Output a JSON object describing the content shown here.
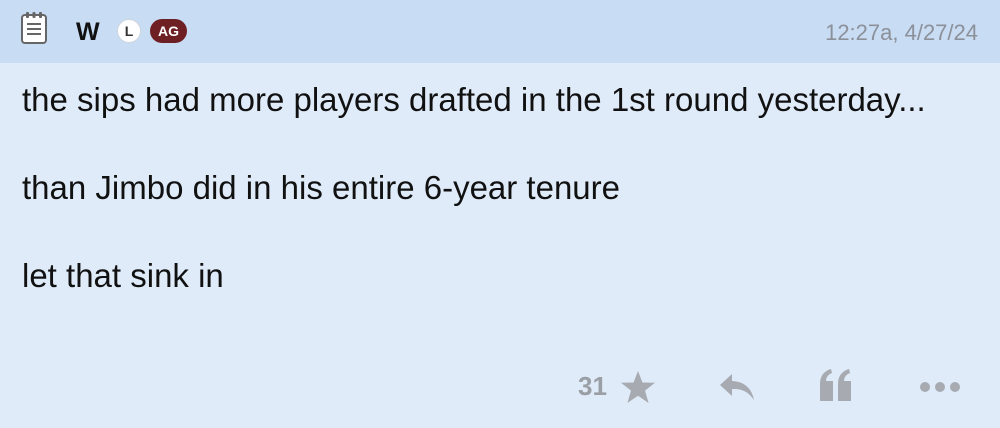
{
  "post": {
    "author": "W",
    "badges": {
      "level": "L",
      "team": "AG"
    },
    "timestamp": "12:27a, 4/27/24",
    "body": [
      "the sips had more players drafted in the 1st round yesterday...",
      "than Jimbo did in his entire 6-year tenure",
      "let that sink in"
    ],
    "actions": {
      "like_count": "31"
    }
  },
  "icons": {
    "header": "notepad-icon",
    "star": "star-icon",
    "reply": "reply-icon",
    "quote": "quote-icon",
    "more": "more-dots-icon"
  },
  "colors": {
    "header_bg": "#c8dcf4",
    "body_bg": "#dfebf9",
    "team_badge": "#6e1f24",
    "muted_icon": "#a7abb1"
  }
}
